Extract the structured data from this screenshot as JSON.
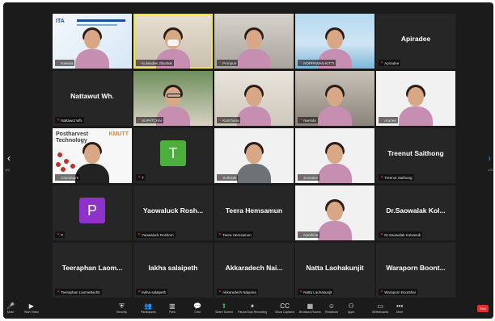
{
  "participants": [
    {
      "name": "Kaewta",
      "display": "",
      "label": "Kaewta",
      "muted": true,
      "type": "banner"
    },
    {
      "name": "Kulwadee",
      "display": "",
      "label": "Kulwadee Jibunluk",
      "muted": true,
      "type": "video",
      "bg": "vid-wall",
      "mask": true,
      "active": true
    },
    {
      "name": "Pornpun",
      "display": "",
      "label": "Pornpun",
      "muted": true,
      "type": "video",
      "bg": "vid-grey"
    },
    {
      "name": "Noppawan",
      "display": "",
      "label": "NOPPAWAN KITTI",
      "muted": true,
      "type": "video",
      "bg": "vid-blue"
    },
    {
      "name": "Apiradee",
      "display": "Apiradee",
      "label": "Apiradee",
      "muted": true,
      "type": "name"
    },
    {
      "name": "Nattawut Wh.",
      "display": "Nattawut Wh.",
      "label": "Nattawut Wh.",
      "muted": true,
      "type": "name"
    },
    {
      "name": "Supatchai",
      "display": "",
      "label": "SUPATCHAI",
      "muted": true,
      "type": "video",
      "bg": "vid-green",
      "glasses": true
    },
    {
      "name": "Kanchana",
      "display": "",
      "label": "Kanchana",
      "muted": true,
      "type": "video",
      "bg": "vid-beige"
    },
    {
      "name": "Nantida",
      "display": "",
      "label": "Nantida",
      "muted": true,
      "type": "video",
      "bg": "vid-room"
    },
    {
      "name": "Arunee",
      "display": "",
      "label": "Arunee",
      "muted": true,
      "type": "video",
      "bg": "vid-white"
    },
    {
      "name": "Chanintorn",
      "display": "",
      "label": "Chanintorn",
      "muted": true,
      "type": "poster"
    },
    {
      "name": "T",
      "display": "",
      "label": "T",
      "muted": true,
      "type": "avatar",
      "letter": "T",
      "color": "#4caf3c"
    },
    {
      "name": "Suthisak",
      "display": "",
      "label": "Suthisak",
      "muted": true,
      "type": "video",
      "bg": "vid-white",
      "suit": true
    },
    {
      "name": "Sumalee",
      "display": "",
      "label": "Sumalee",
      "muted": true,
      "type": "video",
      "bg": "vid-white"
    },
    {
      "name": "Treenut Saithong",
      "display": "Treenut Saithong",
      "label": "Treenut Saithong",
      "muted": true,
      "type": "name"
    },
    {
      "name": "P",
      "display": "",
      "label": "P",
      "muted": true,
      "type": "avatar",
      "letter": "P",
      "color": "#8d33c9"
    },
    {
      "name": "Yaowaluck Rosh...",
      "display": "Yaowaluck Rosh...",
      "label": "Yaowaluck Roshom",
      "muted": true,
      "type": "name"
    },
    {
      "name": "Teera Hemsamun",
      "display": "Teera Hemsamun",
      "label": "Teera Hemsamun",
      "muted": true,
      "type": "name"
    },
    {
      "name": "Nanthida",
      "display": "",
      "label": "Nanthida",
      "muted": true,
      "type": "video",
      "bg": "vid-white"
    },
    {
      "name": "Dr.Saowalak Kol...",
      "display": "Dr.Saowalak Kol...",
      "label": "Dr.Saowalak Kolsanuk",
      "muted": true,
      "type": "name"
    },
    {
      "name": "Teeraphan Laom...",
      "display": "Teeraphan Laom...",
      "label": "Teeraphan Laomettachit",
      "muted": true,
      "type": "name"
    },
    {
      "name": "lakha salaipeth",
      "display": "lakha salaipeth",
      "label": "lakha salaipeth",
      "muted": true,
      "type": "name"
    },
    {
      "name": "Akkaradech Nai...",
      "display": "Akkaradech Nai...",
      "label": "Akkaradech Naiyana",
      "muted": true,
      "type": "name"
    },
    {
      "name": "Natta Laohakunjit",
      "display": "Natta Laohakunjit",
      "label": "Natta Laohakunjit",
      "muted": true,
      "type": "name"
    },
    {
      "name": "Waraporn Boont...",
      "display": "Waraporn Boont...",
      "label": "Waraporn Boonthai",
      "muted": true,
      "type": "name"
    }
  ],
  "poster": {
    "title_line1": "Postharvest",
    "title_line2": "Technology",
    "brand": "KMUTT"
  },
  "banner": {
    "logo": "ITA"
  },
  "nav": {
    "left": "‹",
    "right": "›",
    "left_page": "1/3",
    "right_page": "1/3"
  },
  "toolbar": {
    "items": [
      {
        "label": "Mute",
        "icon": "🎤"
      },
      {
        "label": "Start Video",
        "icon": "▶"
      },
      {
        "label": "Security",
        "icon": "⛨"
      },
      {
        "label": "Participants",
        "icon": "👥"
      },
      {
        "label": "Polls",
        "icon": "▥"
      },
      {
        "label": "Chat",
        "icon": "💬"
      },
      {
        "label": "Share Screen",
        "icon": "⬆"
      },
      {
        "label": "Pause/Stop Recording",
        "icon": "⏸"
      },
      {
        "label": "Show Captions",
        "icon": "CC"
      },
      {
        "label": "Breakout Rooms",
        "icon": "▦"
      },
      {
        "label": "Reactions",
        "icon": "☺"
      },
      {
        "label": "Apps",
        "icon": "⚇"
      },
      {
        "label": "Whiteboards",
        "icon": "▭"
      },
      {
        "label": "More",
        "icon": "•••"
      }
    ],
    "end_label": "End"
  }
}
